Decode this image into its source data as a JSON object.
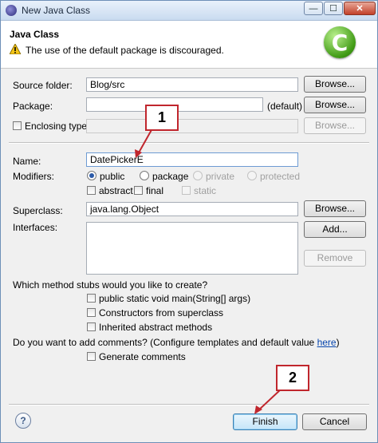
{
  "window": {
    "title": "New Java Class",
    "controls": {
      "minimize": "—",
      "maximize": "☐",
      "close": "✕"
    }
  },
  "header": {
    "title": "Java Class",
    "message": "The use of the default package is discouraged.",
    "logo_letter": "C"
  },
  "form": {
    "source_folder": {
      "label": "Source folder:",
      "value": "Blog/src",
      "browse": "Browse..."
    },
    "package": {
      "label": "Package:",
      "value": "",
      "suffix": "(default)",
      "browse": "Browse..."
    },
    "enclosing_type": {
      "label": "Enclosing type:",
      "value": "",
      "browse": "Browse..."
    },
    "name": {
      "label": "Name:",
      "value": "DatePickerE"
    },
    "modifiers": {
      "label": "Modifiers:",
      "access": [
        {
          "label": "public",
          "checked": true,
          "enabled": true
        },
        {
          "label": "package",
          "checked": false,
          "enabled": true
        },
        {
          "label": "private",
          "checked": false,
          "enabled": false
        },
        {
          "label": "protected",
          "checked": false,
          "enabled": false
        }
      ],
      "flags": [
        {
          "label": "abstract",
          "checked": false,
          "enabled": true
        },
        {
          "label": "final",
          "checked": false,
          "enabled": true
        },
        {
          "label": "static",
          "checked": false,
          "enabled": false
        }
      ]
    },
    "superclass": {
      "label": "Superclass:",
      "value": "java.lang.Object",
      "browse": "Browse..."
    },
    "interfaces": {
      "label": "Interfaces:",
      "add": "Add...",
      "remove": "Remove"
    },
    "stubs": {
      "question": "Which method stubs would you like to create?",
      "options": [
        "public static void main(String[] args)",
        "Constructors from superclass",
        "Inherited abstract methods"
      ]
    },
    "comments": {
      "question_prefix": "Do you want to add comments? (Configure templates and default value ",
      "link": "here",
      "question_suffix": ")",
      "option": "Generate comments"
    }
  },
  "footer": {
    "help": "?",
    "finish": "Finish",
    "cancel": "Cancel"
  },
  "annotations": {
    "callout_1": "1",
    "callout_2": "2"
  }
}
